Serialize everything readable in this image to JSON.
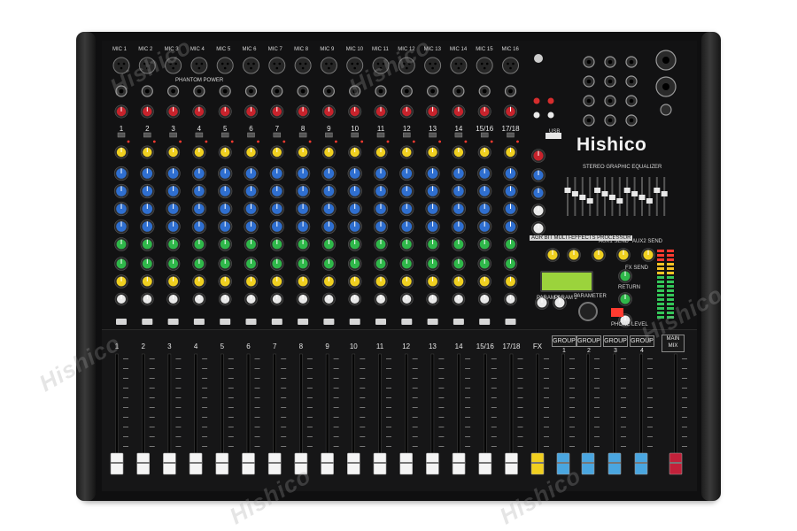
{
  "brand": "Hishico",
  "watermark": "Hishico",
  "panel_labels": {
    "stereo_eq": "STEREO GRAPHIC EQUALIZER",
    "fx_processor": "AGR BIT MULTI-EFFECTS PROCESSOR",
    "phantom": "PHANTOM POWER",
    "usb": "USB",
    "param1": "PARAM 1",
    "param2": "PARAM 2",
    "parameter": "PARAMETER",
    "phone_level": "PHONE LEVEL",
    "return": "RETURN",
    "aux1_send": "AUX1 SEND",
    "aux2_send": "AUX2 SEND",
    "fx_send": "FX SEND"
  },
  "mic_labels": [
    "MIC 1",
    "MIC 2",
    "MIC 3",
    "MIC 4",
    "MIC 5",
    "MIC 6",
    "MIC 7",
    "MIC 8",
    "MIC 9",
    "MIC 10",
    "MIC 11",
    "MIC 12",
    "MIC 13",
    "MIC 14",
    "MIC 15",
    "MIC 16"
  ],
  "channel_numbers": [
    "1",
    "2",
    "3",
    "4",
    "5",
    "6",
    "7",
    "8",
    "9",
    "10",
    "11",
    "12",
    "13",
    "14",
    "15/16",
    "17/18"
  ],
  "fader_labels": [
    "1",
    "2",
    "3",
    "4",
    "5",
    "6",
    "7",
    "8",
    "9",
    "10",
    "11",
    "12",
    "13",
    "14",
    "15/16",
    "17/18",
    "FX"
  ],
  "group_labels": [
    "GROUP 1",
    "GROUP 2",
    "GROUP 3",
    "GROUP 4"
  ],
  "main_mix": "MAIN MIX",
  "colors": {
    "gain": "#c8232c",
    "comp": "#f0d020",
    "eq": "#2f6fd0",
    "aux": "#2fb84a",
    "fx_send": "#f0d020",
    "fader_cap": "#f4f4f4",
    "fx_cap": "#f1cf1f",
    "group_cap": "#4aa6e0",
    "main_cap": "#c2213a",
    "lcd": "#9bd33c"
  }
}
